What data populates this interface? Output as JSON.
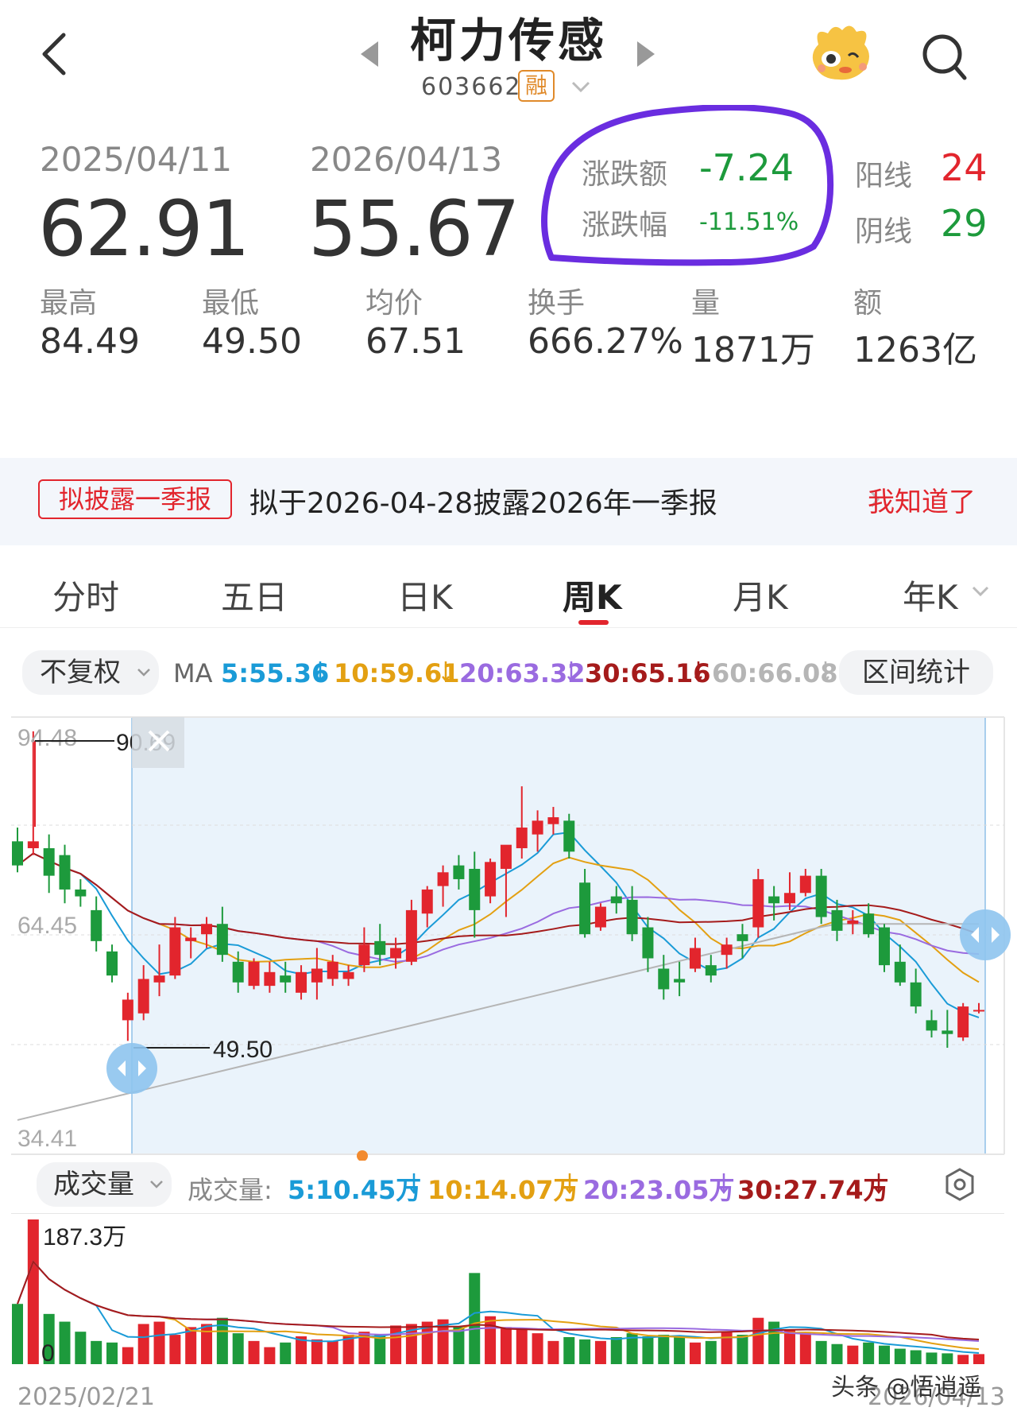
{
  "header": {
    "title": "柯力传感",
    "code": "603662",
    "rong": "融"
  },
  "summary": {
    "start_date": "2025/04/11",
    "start_price": "62.91",
    "end_date": "2026/04/13",
    "end_price": "55.67",
    "change_amount_label": "涨跌额",
    "change_amount": "-7.24",
    "change_pct_label": "涨跌幅",
    "change_pct": "-11.51%",
    "yang_label": "阳线",
    "yang_count": "24",
    "yin_label": "阴线",
    "yin_count": "29",
    "stats": [
      {
        "label": "最高",
        "value": "84.49"
      },
      {
        "label": "最低",
        "value": "49.50"
      },
      {
        "label": "均价",
        "value": "67.51"
      },
      {
        "label": "换手",
        "value": "666.27%"
      },
      {
        "label": "量",
        "value": "1871万"
      },
      {
        "label": "额",
        "value": "1263亿"
      }
    ]
  },
  "notice": {
    "tag": "拟披露一季报",
    "text": "拟于2026-04-28披露2026年一季报",
    "button": "我知道了"
  },
  "tabs": [
    "分时",
    "五日",
    "日K",
    "周K",
    "月K",
    "年K"
  ],
  "active_tab": "周K",
  "ma": {
    "adjust": "不复权",
    "label": "MA",
    "items": [
      {
        "text": "5:55.36",
        "color": "#1a9bd7"
      },
      {
        "text": "10:59.61",
        "color": "#e3a012"
      },
      {
        "text": "20:63.32",
        "color": "#9a6be0"
      },
      {
        "text": "30:65.16",
        "color": "#a51b1b"
      },
      {
        "text": "60:66.08",
        "color": "#b5b5b5"
      }
    ],
    "range_button": "区间统计"
  },
  "volume": {
    "selector": "成交量",
    "label": "成交量:",
    "items": [
      {
        "text": "5:10.45万",
        "color": "#1a9bd7"
      },
      {
        "text": "10:14.07万",
        "color": "#e3a012"
      },
      {
        "text": "20:23.05万",
        "color": "#9a6be0"
      },
      {
        "text": "30:27.74万",
        "color": "#a51b1b"
      }
    ]
  },
  "footer": {
    "date_left": "2025/02/21",
    "date_right": "2026/04/13",
    "watermark": "头条 @悟逍遥"
  },
  "colors": {
    "up": "#e2252d",
    "down": "#1d9a3c",
    "accent": "#e2252d"
  },
  "chart_data": {
    "type": "candlestick",
    "period": "weekly",
    "price_axis_labels": [
      "94.48",
      "64.45",
      "34.41"
    ],
    "ylim": [
      34.41,
      94.48
    ],
    "markers": {
      "high": "90.69",
      "low": "49.50"
    },
    "volume_axis_labels": [
      "187.3万",
      "0"
    ],
    "candles": [
      {
        "o": 78.5,
        "h": 80.5,
        "l": 74.0,
        "c": 75.0
      },
      {
        "o": 77.5,
        "h": 94.48,
        "l": 76.5,
        "c": 78.5
      },
      {
        "o": 77.5,
        "h": 79.5,
        "l": 71.0,
        "c": 73.5
      },
      {
        "o": 76.5,
        "h": 78.0,
        "l": 69.5,
        "c": 71.5
      },
      {
        "o": 71.5,
        "h": 73.0,
        "l": 69.0,
        "c": 70.5
      },
      {
        "o": 68.5,
        "h": 70.5,
        "l": 62.5,
        "c": 64.0
      },
      {
        "o": 62.5,
        "h": 63.5,
        "l": 58.0,
        "c": 59.0
      },
      {
        "o": 52.5,
        "h": 56.5,
        "l": 49.5,
        "c": 55.5
      },
      {
        "o": 53.5,
        "h": 60.5,
        "l": 52.5,
        "c": 58.5
      },
      {
        "o": 58.0,
        "h": 63.5,
        "l": 56.0,
        "c": 59.0
      },
      {
        "o": 59.0,
        "h": 67.5,
        "l": 58.5,
        "c": 66.0
      },
      {
        "o": 64.0,
        "h": 66.0,
        "l": 61.5,
        "c": 64.5
      },
      {
        "o": 65.0,
        "h": 67.5,
        "l": 63.0,
        "c": 66.5
      },
      {
        "o": 66.5,
        "h": 69.0,
        "l": 61.0,
        "c": 62.0
      },
      {
        "o": 61.0,
        "h": 62.5,
        "l": 56.5,
        "c": 58.0
      },
      {
        "o": 57.5,
        "h": 61.5,
        "l": 57.0,
        "c": 61.0
      },
      {
        "o": 57.5,
        "h": 61.0,
        "l": 56.5,
        "c": 59.5
      },
      {
        "o": 59.0,
        "h": 61.0,
        "l": 56.5,
        "c": 58.0
      },
      {
        "o": 56.5,
        "h": 60.5,
        "l": 55.5,
        "c": 59.5
      },
      {
        "o": 58.0,
        "h": 63.0,
        "l": 55.5,
        "c": 60.0
      },
      {
        "o": 58.5,
        "h": 62.0,
        "l": 57.5,
        "c": 61.0
      },
      {
        "o": 58.5,
        "h": 60.5,
        "l": 57.5,
        "c": 59.5
      },
      {
        "o": 60.5,
        "h": 66.0,
        "l": 59.5,
        "c": 63.5
      },
      {
        "o": 64.0,
        "h": 66.5,
        "l": 60.5,
        "c": 62.0
      },
      {
        "o": 61.5,
        "h": 64.5,
        "l": 60.0,
        "c": 63.0
      },
      {
        "o": 61.0,
        "h": 70.0,
        "l": 60.5,
        "c": 68.5
      },
      {
        "o": 68.0,
        "h": 72.0,
        "l": 66.0,
        "c": 71.5
      },
      {
        "o": 72.0,
        "h": 75.0,
        "l": 69.0,
        "c": 74.0
      },
      {
        "o": 75.0,
        "h": 76.5,
        "l": 71.5,
        "c": 73.0
      },
      {
        "o": 74.5,
        "h": 77.0,
        "l": 64.5,
        "c": 68.5
      },
      {
        "o": 70.5,
        "h": 76.0,
        "l": 69.5,
        "c": 75.5
      },
      {
        "o": 74.5,
        "h": 77.5,
        "l": 67.5,
        "c": 78.0
      },
      {
        "o": 77.5,
        "h": 86.5,
        "l": 76.0,
        "c": 80.5
      },
      {
        "o": 79.5,
        "h": 83.0,
        "l": 77.0,
        "c": 81.5
      },
      {
        "o": 81.0,
        "h": 83.5,
        "l": 79.5,
        "c": 82.0
      },
      {
        "o": 81.5,
        "h": 82.5,
        "l": 76.0,
        "c": 77.0
      },
      {
        "o": 72.5,
        "h": 74.5,
        "l": 64.5,
        "c": 65.0
      },
      {
        "o": 66.0,
        "h": 69.5,
        "l": 65.5,
        "c": 69.0
      },
      {
        "o": 70.5,
        "h": 72.0,
        "l": 68.0,
        "c": 69.5
      },
      {
        "o": 70.0,
        "h": 72.0,
        "l": 64.0,
        "c": 65.0
      },
      {
        "o": 66.0,
        "h": 67.5,
        "l": 59.5,
        "c": 61.5
      },
      {
        "o": 60.0,
        "h": 62.0,
        "l": 55.5,
        "c": 57.0
      },
      {
        "o": 58.5,
        "h": 61.0,
        "l": 56.0,
        "c": 58.0
      },
      {
        "o": 60.0,
        "h": 64.5,
        "l": 59.5,
        "c": 63.0
      },
      {
        "o": 60.5,
        "h": 62.0,
        "l": 58.0,
        "c": 59.0
      },
      {
        "o": 62.0,
        "h": 64.5,
        "l": 60.0,
        "c": 63.5
      },
      {
        "o": 65.0,
        "h": 66.5,
        "l": 61.5,
        "c": 64.0
      },
      {
        "o": 66.0,
        "h": 74.5,
        "l": 64.5,
        "c": 73.0
      },
      {
        "o": 70.5,
        "h": 72.0,
        "l": 67.0,
        "c": 69.5
      },
      {
        "o": 69.5,
        "h": 74.0,
        "l": 68.5,
        "c": 71.0
      },
      {
        "o": 71.0,
        "h": 74.5,
        "l": 70.5,
        "c": 73.5
      },
      {
        "o": 73.5,
        "h": 74.5,
        "l": 66.5,
        "c": 67.5
      },
      {
        "o": 68.5,
        "h": 70.0,
        "l": 64.0,
        "c": 65.5
      },
      {
        "o": 66.5,
        "h": 68.5,
        "l": 65.0,
        "c": 67.0
      },
      {
        "o": 68.0,
        "h": 69.5,
        "l": 64.5,
        "c": 65.0
      },
      {
        "o": 66.0,
        "h": 66.5,
        "l": 59.5,
        "c": 60.5
      },
      {
        "o": 61.0,
        "h": 63.5,
        "l": 57.5,
        "c": 58.0
      },
      {
        "o": 58.0,
        "h": 60.0,
        "l": 53.5,
        "c": 54.5
      },
      {
        "o": 52.5,
        "h": 54.0,
        "l": 50.0,
        "c": 51.0
      },
      {
        "o": 51.0,
        "h": 54.0,
        "l": 48.5,
        "c": 50.5
      },
      {
        "o": 50.0,
        "h": 55.0,
        "l": 49.5,
        "c": 54.5
      },
      {
        "o": 54.0,
        "h": 55.0,
        "l": 53.5,
        "c": 54.0
      }
    ],
    "volumes": [
      78,
      187.3,
      65,
      55,
      42,
      30,
      28,
      22,
      52,
      55,
      38,
      48,
      52,
      60,
      40,
      30,
      22,
      28,
      36,
      32,
      30,
      38,
      42,
      38,
      50,
      52,
      55,
      58,
      48,
      118,
      62,
      48,
      45,
      40,
      30,
      35,
      32,
      30,
      35,
      40,
      36,
      38,
      35,
      28,
      30,
      42,
      38,
      60,
      55,
      45,
      40,
      30,
      26,
      24,
      28,
      24,
      20,
      18,
      15,
      14,
      12,
      13
    ]
  }
}
